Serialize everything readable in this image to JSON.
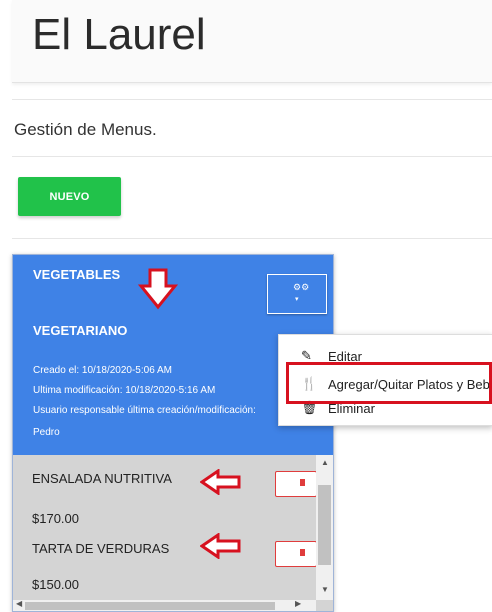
{
  "app": {
    "title": "El Laurel"
  },
  "page": {
    "subtitle": "Gestión de Menus."
  },
  "toolbar": {
    "new_label": "NUEVO"
  },
  "menu_card": {
    "name": "VEGETABLES",
    "category": "VEGETARIANO",
    "created": "Creado el: 10/18/2020-5:06 AM",
    "modified": "Ultima modificación: 10/18/2020-5:16 AM",
    "responsible": "Usuario responsable última creación/modificación:",
    "user": "Pedro",
    "dishes": [
      {
        "name": "ENSALADA NUTRITIVA",
        "price": "$170.00"
      },
      {
        "name": "TARTA DE VERDURAS",
        "price": "$150.00"
      }
    ]
  },
  "dropdown": {
    "items": [
      {
        "label": "Editar",
        "icon": "edit-icon"
      },
      {
        "label": "Agregar/Quitar Platos y Bebidas",
        "icon": "cutlery-icon"
      },
      {
        "label": "Eliminar",
        "icon": "trash-icon"
      }
    ]
  },
  "colors": {
    "card_header": "#3f82e6",
    "new_button": "#21c24a",
    "annotation": "#d7111f"
  }
}
